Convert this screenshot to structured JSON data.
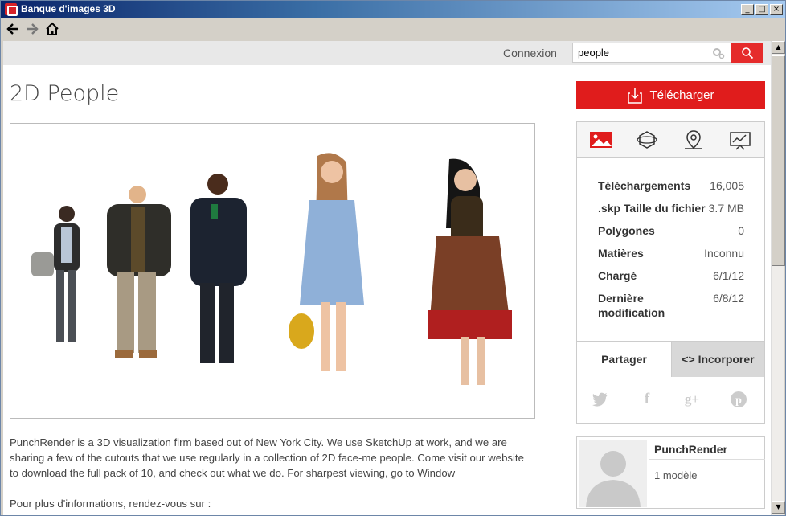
{
  "window": {
    "title": "Banque d'images 3D",
    "controls": [
      "_",
      "□",
      "×"
    ]
  },
  "nav": {
    "back": "back-arrow",
    "forward": "forward-arrow",
    "home": "home"
  },
  "topbar": {
    "login_label": "Connexion",
    "search_value": "people"
  },
  "model": {
    "title": "2D People",
    "description": "PunchRender is a 3D visualization firm based out of New York City. We use SketchUp at work, and we are sharing a few of the cutouts that we use regularly in a collection of 2D face-me people. Come visit our website to download the full pack of 10, and check out what we do. For sharpest viewing, go to Window",
    "more_info": "Pour plus d'informations, rendez-vous sur :"
  },
  "download_label": "Télécharger",
  "stats": [
    {
      "label": "Téléchargements",
      "value": "16,005"
    },
    {
      "label": ".skp Taille du fichier",
      "value": "3.7 MB"
    },
    {
      "label": "Polygones",
      "value": "0"
    },
    {
      "label": "Matières",
      "value": "Inconnu"
    },
    {
      "label": "Chargé",
      "value": "6/1/12"
    },
    {
      "label": "Dernière modification",
      "value": "6/8/12"
    }
  ],
  "share": {
    "share_label": "Partager",
    "embed_label": "<> Incorporer",
    "networks": [
      "twitter",
      "facebook",
      "google-plus",
      "pinterest"
    ]
  },
  "author": {
    "name": "PunchRender",
    "models": "1 modèle"
  },
  "colors": {
    "accent": "#e01c1c",
    "search_button": "#e52b2b"
  }
}
